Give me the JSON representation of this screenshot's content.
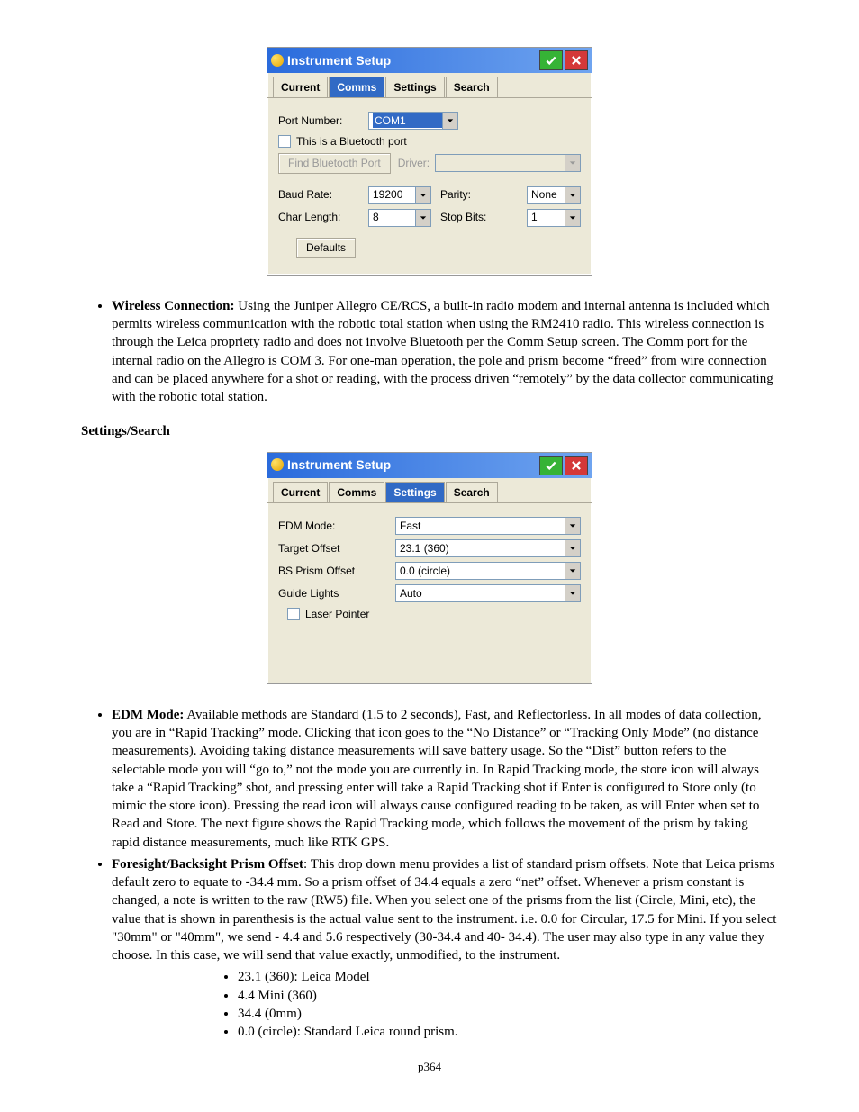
{
  "dialog1": {
    "title": "Instrument Setup",
    "tabs": [
      "Current",
      "Comms",
      "Settings",
      "Search"
    ],
    "active_tab": 1,
    "port_label": "Port Number:",
    "port_value": "COM1",
    "bluetooth_check": "This is a Bluetooth port",
    "find_bt_btn": "Find Bluetooth Port",
    "driver_label": "Driver:",
    "driver_value": "",
    "baud_label": "Baud Rate:",
    "baud_value": "19200",
    "parity_label": "Parity:",
    "parity_value": "None",
    "char_label": "Char Length:",
    "char_value": "8",
    "stop_label": "Stop Bits:",
    "stop_value": "1",
    "defaults_btn": "Defaults"
  },
  "para1_lead": "Wireless Connection:",
  "para1_body": "  Using the Juniper Allegro CE/RCS, a built-in radio modem and internal antenna is included which permits wireless communication with the robotic total station when using the RM2410 radio.  This wireless connection is through the Leica propriety radio and does not involve Bluetooth per the Comm Setup screen.  The Comm port for the internal radio on the Allegro is COM 3.  For one-man operation, the pole and prism become “freed” from wire connection and can be placed anywhere for a shot or reading, with the process driven “remotely” by the data collector communicating with the robotic total station.",
  "section_head": "Settings/Search",
  "dialog2": {
    "title": "Instrument Setup",
    "tabs": [
      "Current",
      "Comms",
      "Settings",
      "Search"
    ],
    "active_tab": 2,
    "edm_label": "EDM Mode:",
    "edm_value": "Fast",
    "target_label": "Target Offset",
    "target_value": "23.1 (360)",
    "bs_label": "BS Prism Offset",
    "bs_value": "0.0 (circle)",
    "guide_label": "Guide Lights",
    "guide_value": "Auto",
    "laser_check": "Laser Pointer"
  },
  "para2_lead": "EDM Mode:",
  "para2_body": "  Available methods are Standard (1.5 to 2 seconds), Fast, and Reflectorless.  In all modes of data collection, you are in “Rapid Tracking” mode.  Clicking that icon goes to the “No Distance” or “Tracking Only Mode” (no distance measurements).  Avoiding taking distance measurements will save battery usage.  So the “Dist” button refers to the selectable mode you will “go to,” not the mode you are currently in. In Rapid Tracking mode, the store icon will always take a “Rapid Tracking” shot, and pressing enter will take a Rapid Tracking shot if Enter is configured to Store only (to mimic the store icon).  Pressing the read icon will always cause configured reading to be taken, as will Enter when set to Read and Store. The next figure shows the Rapid Tracking mode, which follows the movement of the prism by taking rapid distance measurements, much like RTK GPS.",
  "para3_lead": "Foresight/Backsight Prism Offset",
  "para3_body": ": This drop down menu provides a list of standard prism offsets.  Note that Leica prisms default zero to equate to -34.4 mm.  So a prism offset of 34.4 equals a zero “net” offset.  Whenever a prism constant is changed, a note is written to the raw (RW5) file. When you select one of the prisms from the list (Circle, Mini, etc), the value that is shown in parenthesis is the actual value sent to the instrument.  i.e. 0.0 for Circular, 17.5 for Mini.  If you select \"30mm\" or \"40mm\", we send - 4.4 and 5.6 respectively (30-34.4 and 40- 34.4).  The user may also type in any value they choose.  In this case, we will send that value exactly, unmodified, to the instrument.",
  "prism_list": [
    "23.1 (360): Leica Model",
    "4.4 Mini (360)",
    "34.4 (0mm)",
    "0.0 (circle):  Standard Leica round prism."
  ],
  "page_number": "p364"
}
